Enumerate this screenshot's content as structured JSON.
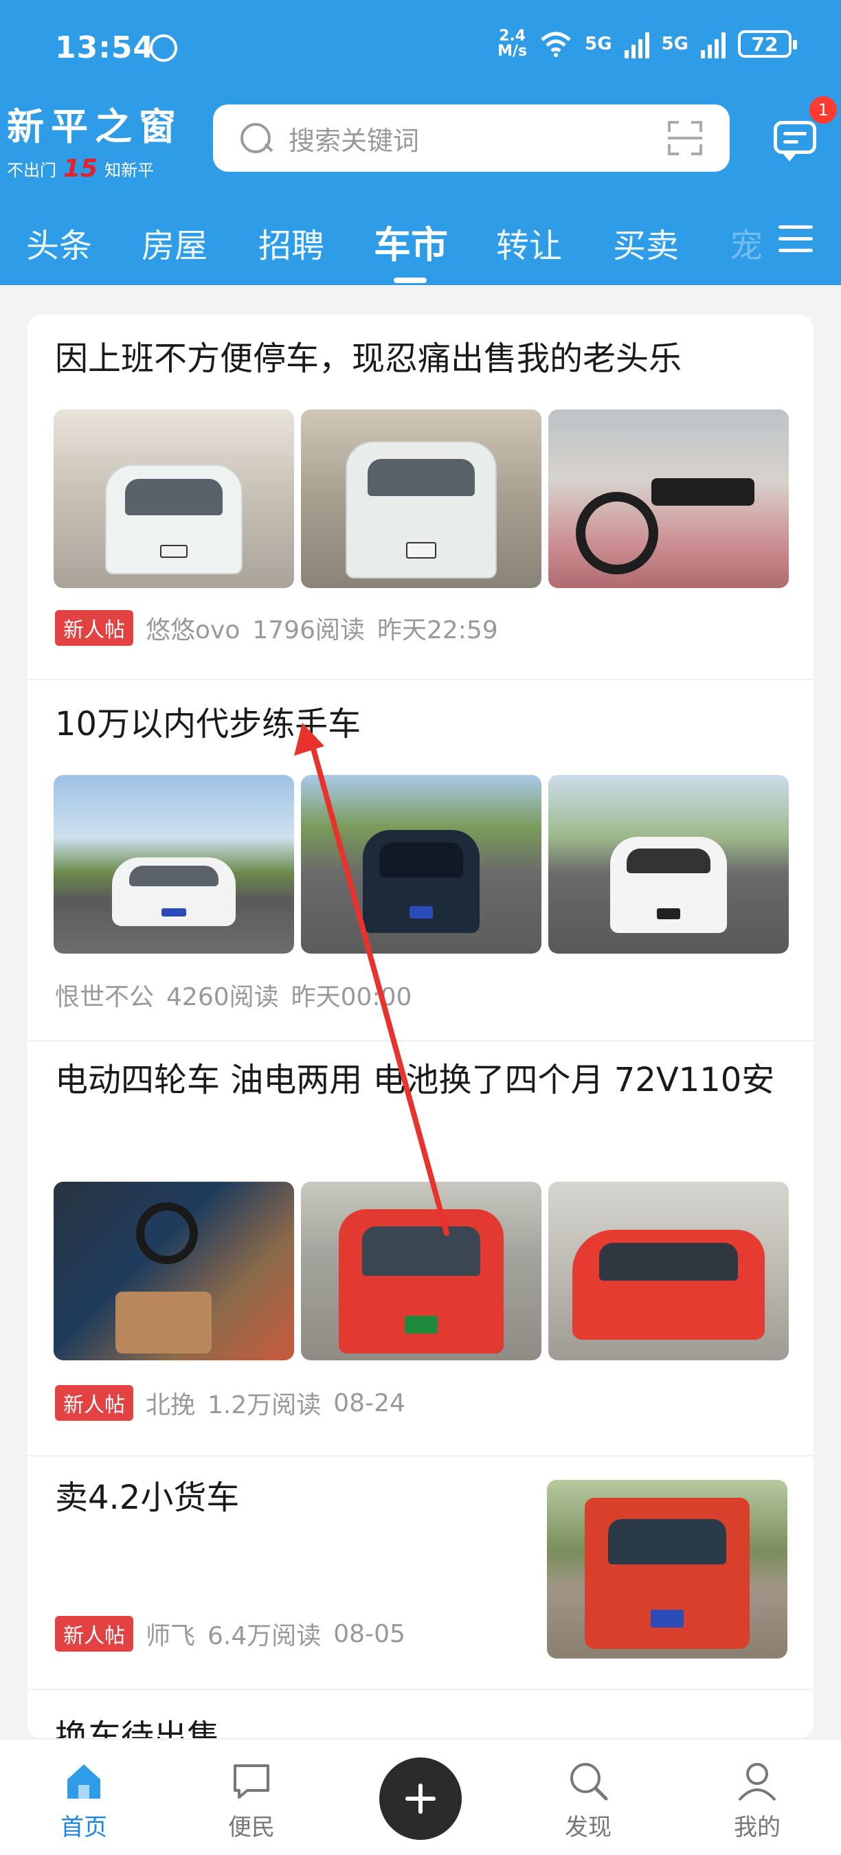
{
  "status_bar": {
    "time": "13:54",
    "net_speed_top": "2.4",
    "net_speed_bottom": "M/s",
    "signal1": "5G",
    "signal2": "5G",
    "battery": "72"
  },
  "header": {
    "logo_title": "新平之窗",
    "logo_sub_left": "不出门",
    "logo_sub_num": "15",
    "logo_sub_right": "知新平",
    "search_placeholder": "搜索关键词",
    "message_badge": "1"
  },
  "tabs": [
    "头条",
    "房屋",
    "招聘",
    "车市",
    "转让",
    "买卖",
    "宠"
  ],
  "active_tab": "车市",
  "posts": [
    {
      "title": "因上班不方便停车，现忍痛出售我的老头乐",
      "badge": "新人帖",
      "author": "悠悠ovo",
      "reads": "1796阅读",
      "time": "昨天22:59"
    },
    {
      "title": "10万以内代步练手车",
      "badge": "",
      "author": "恨世不公",
      "reads": "4260阅读",
      "time": "昨天00:00"
    },
    {
      "title": "电动四轮车 油电两用 电池换了四个月 72V110安",
      "badge": "新人帖",
      "author": "北挽",
      "reads": "1.2万阅读",
      "time": "08-24"
    },
    {
      "title": "卖4.2小货车",
      "badge": "新人帖",
      "author": "师飞",
      "reads": "6.4万阅读",
      "time": "08-05"
    },
    {
      "title": "换车待出售"
    }
  ],
  "bottom_nav": [
    {
      "label": "首页",
      "icon": "home-icon"
    },
    {
      "label": "便民",
      "icon": "chat-square-icon"
    },
    {
      "label": "",
      "icon": "plus-icon"
    },
    {
      "label": "发现",
      "icon": "search-icon"
    },
    {
      "label": "我的",
      "icon": "person-icon"
    }
  ],
  "colors": {
    "header_blue": "#2f9ce8",
    "badge_red": "#e34242",
    "active_nav": "#1d86e0"
  }
}
